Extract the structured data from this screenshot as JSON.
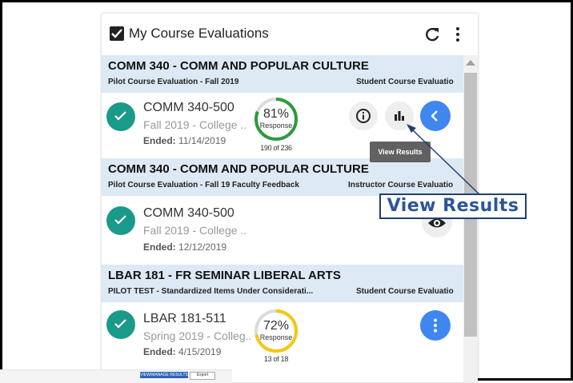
{
  "widget": {
    "title": "My Course Evaluations",
    "refresh_icon": "refresh-icon",
    "menu_icon": "more-vert-icon"
  },
  "courses": [
    {
      "name": "COMM 340 - COMM AND POPULAR CULTURE",
      "evaluation": "Pilot Course Evaluation - Fall 2019",
      "type": "Student Course Evaluatio",
      "section": "COMM 340-500",
      "term": "Fall 2019 - College ..",
      "ended_label": "Ended:",
      "ended_date": "11/14/2019",
      "response_pct": "81%",
      "response_label": "Response",
      "response_count": "190 of 236",
      "response_fraction": 0.81,
      "ring_color": "#2e9a3e"
    },
    {
      "name": "COMM 340 - COMM AND POPULAR CULTURE",
      "evaluation": "Pilot Course Evaluation - Fall 19 Faculty Feedback",
      "type": "Instructor Course Evaluatio",
      "section": "COMM 340-500",
      "term": "Fall 2019 - College ..",
      "ended_label": "Ended:",
      "ended_date": "12/12/2019"
    },
    {
      "name": "LBAR 181 - FR SEMINAR LIBERAL ARTS",
      "evaluation": "PILOT TEST - Standardized Items Under Considerati...",
      "type": "Student Course Evaluatio",
      "section": "LBAR 181-511",
      "term": "Spring 2019 - Colleg..",
      "ended_label": "Ended:",
      "ended_date": "4/15/2019",
      "response_pct": "72%",
      "response_label": "Response",
      "response_count": "13 of 18",
      "response_fraction": 0.72,
      "ring_color": "#f2c811"
    }
  ],
  "tooltip": "View Results",
  "callout": "View Results",
  "footer": {
    "primary_button": "VIEW/MANAGE RESULTS",
    "secondary_button": "Export"
  }
}
